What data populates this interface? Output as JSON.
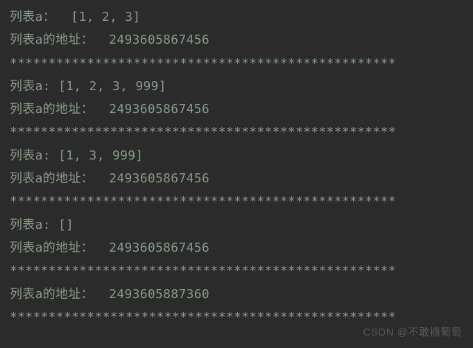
{
  "output": {
    "blocks": [
      {
        "list_line": "列表a：  [1, 2, 3]",
        "addr_line": "列表a的地址：  2493605867456",
        "sep": "**************************************************"
      },
      {
        "list_line": "列表a: [1, 2, 3, 999]",
        "addr_line": "列表a的地址：  2493605867456",
        "sep": "**************************************************"
      },
      {
        "list_line": "列表a: [1, 3, 999]",
        "addr_line": "列表a的地址：  2493605867456",
        "sep": "**************************************************"
      },
      {
        "list_line": "列表a: []",
        "addr_line": "列表a的地址：  2493605867456",
        "sep": "**************************************************"
      },
      {
        "list_line": "",
        "addr_line": "列表a的地址：  2493605887360",
        "sep": "**************************************************"
      }
    ]
  },
  "watermark": "CSDN @不敢摘葡萄"
}
